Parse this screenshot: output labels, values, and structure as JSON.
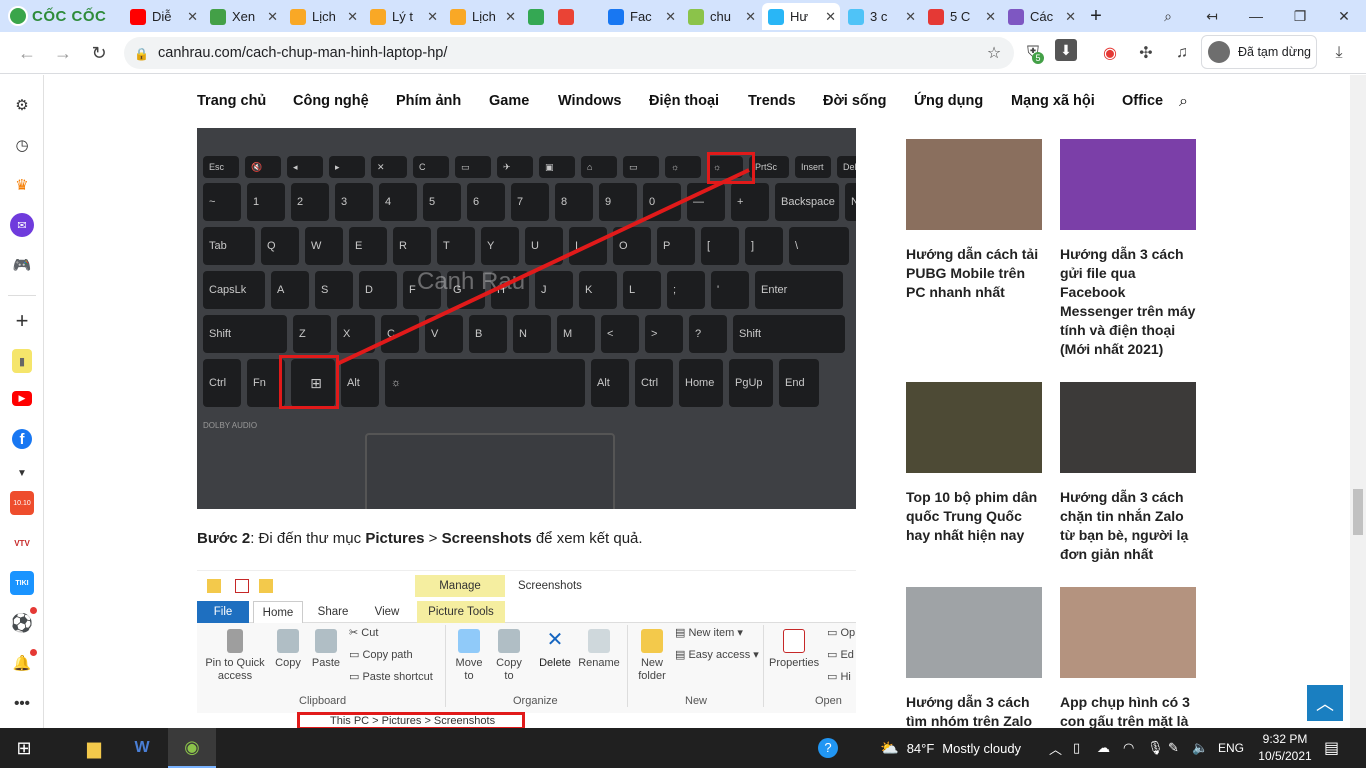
{
  "browser": {
    "logo": "CỐC CỐC",
    "tabs": [
      {
        "title": "Diễ",
        "color": "#ff0000"
      },
      {
        "title": "Xen",
        "color": "#43a047"
      },
      {
        "title": "Lịch",
        "color": "#f9a825"
      },
      {
        "title": "Lý t",
        "color": "#f9a825"
      },
      {
        "title": "Lịch",
        "color": "#f9a825"
      },
      {
        "title": "",
        "color": "#34a853"
      },
      {
        "title": "",
        "color": "#ea4335"
      },
      {
        "title": "Fac",
        "color": "#1877f2"
      },
      {
        "title": "chu",
        "color": "#8bc34a"
      },
      {
        "title": "Hư",
        "color": "#29b6f6"
      },
      {
        "title": "3 c",
        "color": "#4fc3f7"
      },
      {
        "title": "5 C",
        "color": "#e53935"
      },
      {
        "title": "Các",
        "color": "#7e57c2"
      }
    ],
    "url": "canhrau.com/cach-chup-man-hinh-laptop-hp/",
    "extension_badge": "5",
    "profile_label": "Đã tạm dừng"
  },
  "sidebar": {
    "items": [
      "settings-icon",
      "history-icon",
      "crown-icon",
      "messenger-icon",
      "gamepad-icon",
      "add-icon",
      "notes-icon",
      "youtube-icon",
      "facebook-icon",
      "more-down-icon",
      "shopee-icon",
      "vtv-icon",
      "tiki-icon",
      "football-icon",
      "bell-icon",
      "more-icon"
    ],
    "shopee_badge": "10.10",
    "vtv_label": "VTV",
    "tiki_label": "TIKI"
  },
  "nav": {
    "items": [
      "Trang chủ",
      "Công nghệ",
      "Phím ảnh",
      "Game",
      "Windows",
      "Điện thoại",
      "Trends",
      "Đời sống",
      "Ứng dụng",
      "Mạng xã hội",
      "Office"
    ]
  },
  "keyboard": {
    "prtsc_label": "PrtSc",
    "watermark": "Canh Rau",
    "dolby": "DOLBY AUDIO"
  },
  "article": {
    "step_prefix": "Bước 2",
    "step_mid": ": Đi đến thư mục ",
    "pictures": "Pictures",
    "arrow": " > ",
    "screenshots": "Screenshots",
    "step_suffix": " để xem kết quả."
  },
  "explorer": {
    "manage": "Manage",
    "title": "Screenshots",
    "tabs": [
      "File",
      "Home",
      "Share",
      "View",
      "Picture Tools"
    ],
    "ribbon": {
      "pin": "Pin to Quick access",
      "copy": "Copy",
      "paste": "Paste",
      "cut": "Cut",
      "copy_path": "Copy path",
      "paste_shortcut": "Paste shortcut",
      "move_to": "Move to",
      "copy_to": "Copy to",
      "delete": "Delete",
      "rename": "Rename",
      "new_folder": "New folder",
      "new_item": "New item",
      "easy_access": "Easy access",
      "properties": "Properties",
      "open": "Op",
      "edit": "Ed",
      "history": "Hi"
    },
    "groups": [
      "Clipboard",
      "Organize",
      "New",
      "Open"
    ],
    "path": "This PC  >  Pictures  >  Screenshots"
  },
  "related": [
    {
      "title": "Hướng dẫn cách tải PUBG Mobile trên PC nhanh nhất",
      "color": "#8a6f5e"
    },
    {
      "title": "Hướng dẫn 3 cách gửi file qua Facebook Messenger trên máy tính và điện thoại (Mới nhất 2021)",
      "color": "#7b3fa8"
    },
    {
      "title": "Top 10 bộ phim dân quốc Trung Quốc hay nhất hiện nay",
      "color": "#4d4a35"
    },
    {
      "title": "Hướng dẫn 3 cách chặn tin nhắn Zalo từ bạn bè, người lạ đơn giản nhất",
      "color": "#3c3a39"
    },
    {
      "title": "Hướng dẫn 3 cách tìm nhóm trên Zalo",
      "color": "#9fa3a6"
    },
    {
      "title": "App chụp hình có 3 con gấu trên mặt là",
      "color": "#b4937f"
    }
  ],
  "taskbar": {
    "weather_temp": "84°F",
    "weather_text": "Mostly cloudy",
    "language": "ENG",
    "time": "9:32 PM",
    "date": "10/5/2021"
  }
}
